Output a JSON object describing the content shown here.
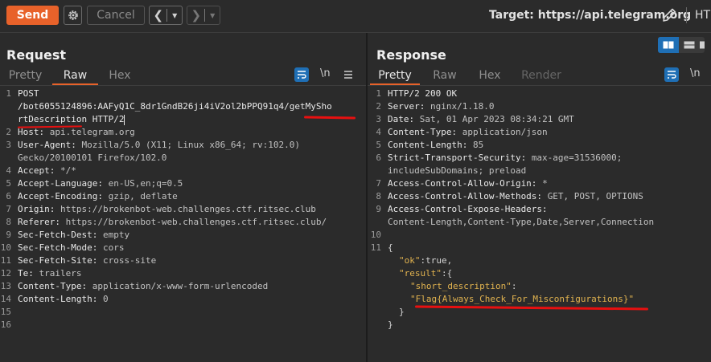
{
  "toolbar": {
    "send_label": "Send",
    "cancel_label": "Cancel",
    "target_label": "Target: https://api.telegram.org",
    "next_tab_label": "HT"
  },
  "request": {
    "title": "Request",
    "tabs": [
      "Pretty",
      "Raw",
      "Hex"
    ],
    "active_tab": "Raw",
    "newline_toggle": "\\n",
    "lines": [
      {
        "n": "1",
        "k": "POST",
        "v": ""
      },
      {
        "n": "",
        "k": "/bot6055124896:AAFyQ1C_8dr1GndB26ji4iV2ol2bPPQ91q4/getMySho",
        "v": ""
      },
      {
        "n": "",
        "k": "rtDescription HTTP/2",
        "v": ""
      },
      {
        "n": "2",
        "k": "Host: ",
        "v": "api.telegram.org"
      },
      {
        "n": "3",
        "k": "User-Agent: ",
        "v": "Mozilla/5.0 (X11; Linux x86_64; rv:102.0)"
      },
      {
        "n": "",
        "k": "",
        "v": "Gecko/20100101 Firefox/102.0"
      },
      {
        "n": "4",
        "k": "Accept: ",
        "v": "*/*"
      },
      {
        "n": "5",
        "k": "Accept-Language: ",
        "v": "en-US,en;q=0.5"
      },
      {
        "n": "6",
        "k": "Accept-Encoding: ",
        "v": "gzip, deflate"
      },
      {
        "n": "7",
        "k": "Origin: ",
        "v": "https://brokenbot-web.challenges.ctf.ritsec.club"
      },
      {
        "n": "8",
        "k": "Referer: ",
        "v": "https://brokenbot-web.challenges.ctf.ritsec.club/"
      },
      {
        "n": "9",
        "k": "Sec-Fetch-Dest: ",
        "v": "empty"
      },
      {
        "n": "10",
        "k": "Sec-Fetch-Mode: ",
        "v": "cors"
      },
      {
        "n": "11",
        "k": "Sec-Fetch-Site: ",
        "v": "cross-site"
      },
      {
        "n": "12",
        "k": "Te: ",
        "v": "trailers"
      },
      {
        "n": "13",
        "k": "Content-Type: ",
        "v": "application/x-www-form-urlencoded"
      },
      {
        "n": "14",
        "k": "Content-Length: ",
        "v": "0"
      },
      {
        "n": "15",
        "k": "",
        "v": ""
      },
      {
        "n": "16",
        "k": "",
        "v": ""
      }
    ]
  },
  "response": {
    "title": "Response",
    "tabs": [
      "Pretty",
      "Raw",
      "Hex",
      "Render"
    ],
    "active_tab": "Pretty",
    "newline_toggle": "\\n",
    "lines": [
      {
        "n": "1",
        "k": "HTTP/2 200 OK",
        "v": ""
      },
      {
        "n": "2",
        "k": "Server: ",
        "v": "nginx/1.18.0"
      },
      {
        "n": "3",
        "k": "Date: ",
        "v": "Sat, 01 Apr 2023 08:34:21 GMT"
      },
      {
        "n": "4",
        "k": "Content-Type: ",
        "v": "application/json"
      },
      {
        "n": "5",
        "k": "Content-Length: ",
        "v": "85"
      },
      {
        "n": "6",
        "k": "Strict-Transport-Security: ",
        "v": "max-age=31536000;"
      },
      {
        "n": "",
        "k": "",
        "v": "includeSubDomains; preload"
      },
      {
        "n": "7",
        "k": "Access-Control-Allow-Origin: ",
        "v": "*"
      },
      {
        "n": "8",
        "k": "Access-Control-Allow-Methods: ",
        "v": "GET, POST, OPTIONS"
      },
      {
        "n": "9",
        "k": "Access-Control-Expose-Headers: ",
        "v": ""
      },
      {
        "n": "",
        "k": "",
        "v": "Content-Length,Content-Type,Date,Server,Connection"
      },
      {
        "n": "10",
        "k": "",
        "v": ""
      },
      {
        "n": "11",
        "k": "",
        "v": "{"
      }
    ],
    "json": {
      "ok_key": "\"ok\"",
      "ok_value": "true,",
      "result_key": "\"result\"",
      "result_open": ":{",
      "desc_key": "\"short_description\"",
      "desc_colon": ":",
      "flag_value": "\"Flag{Always_Check_For_Misconfigurations}\"",
      "inner_close": "}",
      "outer_close": "}"
    }
  },
  "colors": {
    "accent": "#e8622a",
    "toggle_on": "#1f6fb5",
    "annotation": "#e81010",
    "json_string": "#e0b24f"
  }
}
